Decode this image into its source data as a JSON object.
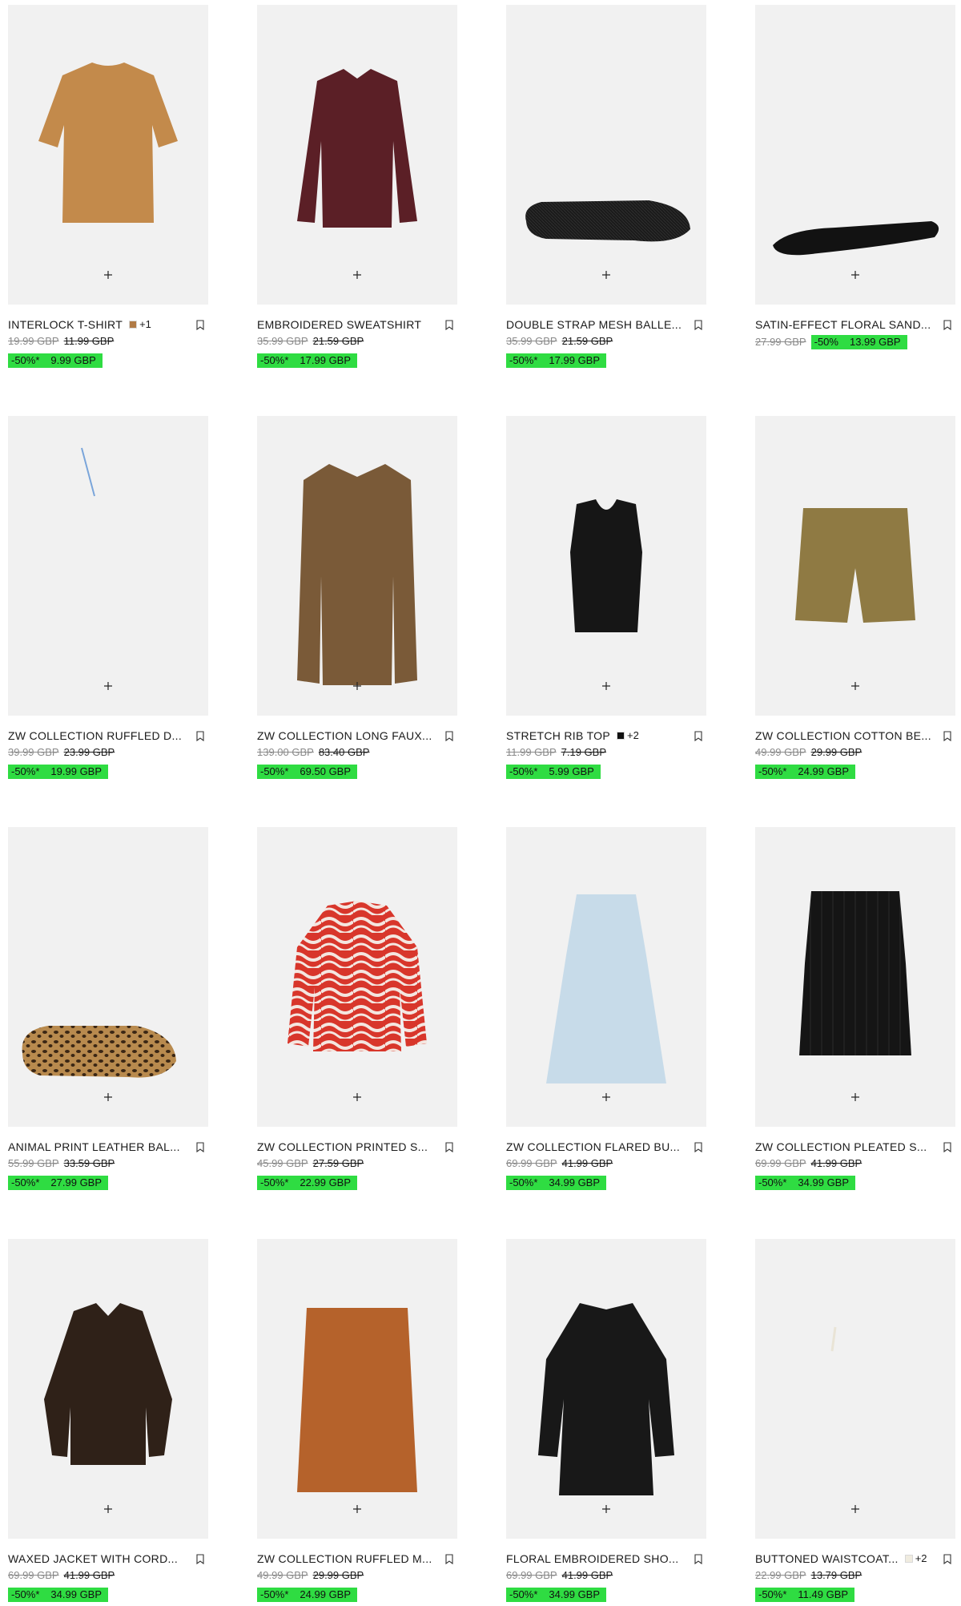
{
  "colors": {
    "sale_badge": "#2fdc42",
    "image_bg": "#f1f1f1",
    "old_price": "#8a8a8a"
  },
  "products": [
    {
      "name": "INTERLOCK T-SHIRT",
      "swatch": "#b07a45",
      "more": "+1",
      "old_price": "19.99 GBP",
      "prev_price": "11.99 GBP",
      "discount": "-50%*",
      "sale_price": "9.99 GBP",
      "icon": "oversized-tshirt-image"
    },
    {
      "name": "EMBROIDERED SWEATSHIRT",
      "old_price": "35.99 GBP",
      "prev_price": "21.59 GBP",
      "discount": "-50%*",
      "sale_price": "17.99 GBP",
      "icon": "track-jacket-image"
    },
    {
      "name": "DOUBLE STRAP MESH BALLE...",
      "old_price": "35.99 GBP",
      "prev_price": "21.59 GBP",
      "discount": "-50%*",
      "sale_price": "17.99 GBP",
      "icon": "mesh-ballet-flat-image"
    },
    {
      "name": "SATIN-EFFECT FLORAL SAND...",
      "old_price": "27.99 GBP",
      "discount": "-50%",
      "sale_price": "13.99 GBP",
      "icon": "floral-sandal-image"
    },
    {
      "name": "ZW COLLECTION RUFFLED D...",
      "old_price": "39.99 GBP",
      "prev_price": "23.99 GBP",
      "discount": "-50%*",
      "sale_price": "19.99 GBP",
      "icon": "ruffled-dress-image"
    },
    {
      "name": "ZW COLLECTION LONG FAUX...",
      "old_price": "139.00 GBP",
      "prev_price": "83.40 GBP",
      "discount": "-50%*",
      "sale_price": "69.50 GBP",
      "icon": "faux-fur-coat-image"
    },
    {
      "name": "STRETCH RIB TOP",
      "swatch": "#111111",
      "more": "+2",
      "old_price": "11.99 GBP",
      "prev_price": "7.19 GBP",
      "discount": "-50%*",
      "sale_price": "5.99 GBP",
      "icon": "rib-top-image"
    },
    {
      "name": "ZW COLLECTION COTTON BE...",
      "old_price": "49.99 GBP",
      "prev_price": "29.99 GBP",
      "discount": "-50%*",
      "sale_price": "24.99 GBP",
      "icon": "bermuda-shorts-image"
    },
    {
      "name": "ANIMAL PRINT LEATHER BAL...",
      "old_price": "55.99 GBP",
      "prev_price": "33.59 GBP",
      "discount": "-50%*",
      "sale_price": "27.99 GBP",
      "icon": "leopard-ballet-flat-image"
    },
    {
      "name": "ZW COLLECTION PRINTED S...",
      "old_price": "45.99 GBP",
      "prev_price": "27.59 GBP",
      "discount": "-50%*",
      "sale_price": "22.99 GBP",
      "icon": "printed-shirt-image"
    },
    {
      "name": "ZW COLLECTION FLARED BU...",
      "old_price": "69.99 GBP",
      "prev_price": "41.99 GBP",
      "discount": "-50%*",
      "sale_price": "34.99 GBP",
      "icon": "flared-skirt-image"
    },
    {
      "name": "ZW COLLECTION PLEATED S...",
      "old_price": "69.99 GBP",
      "prev_price": "41.99 GBP",
      "discount": "-50%*",
      "sale_price": "34.99 GBP",
      "icon": "pleated-skirt-image"
    },
    {
      "name": "WAXED JACKET WITH CORD...",
      "old_price": "69.99 GBP",
      "prev_price": "41.99 GBP",
      "discount": "-50%*",
      "sale_price": "34.99 GBP",
      "icon": "waxed-jacket-image"
    },
    {
      "name": "ZW COLLECTION RUFFLED M...",
      "old_price": "49.99 GBP",
      "prev_price": "29.99 GBP",
      "discount": "-50%*",
      "sale_price": "24.99 GBP",
      "icon": "ruffled-midi-skirt-image"
    },
    {
      "name": "FLORAL EMBROIDERED SHO...",
      "old_price": "69.99 GBP",
      "prev_price": "41.99 GBP",
      "discount": "-50%*",
      "sale_price": "34.99 GBP",
      "icon": "embroidered-dress-image"
    },
    {
      "name": "BUTTONED WAISTCOAT...",
      "swatch": "#f0ece0",
      "more": "+2",
      "old_price": "22.99 GBP",
      "prev_price": "13.79 GBP",
      "discount": "-50%*",
      "sale_price": "11.49 GBP",
      "icon": "waistcoat-image"
    }
  ]
}
